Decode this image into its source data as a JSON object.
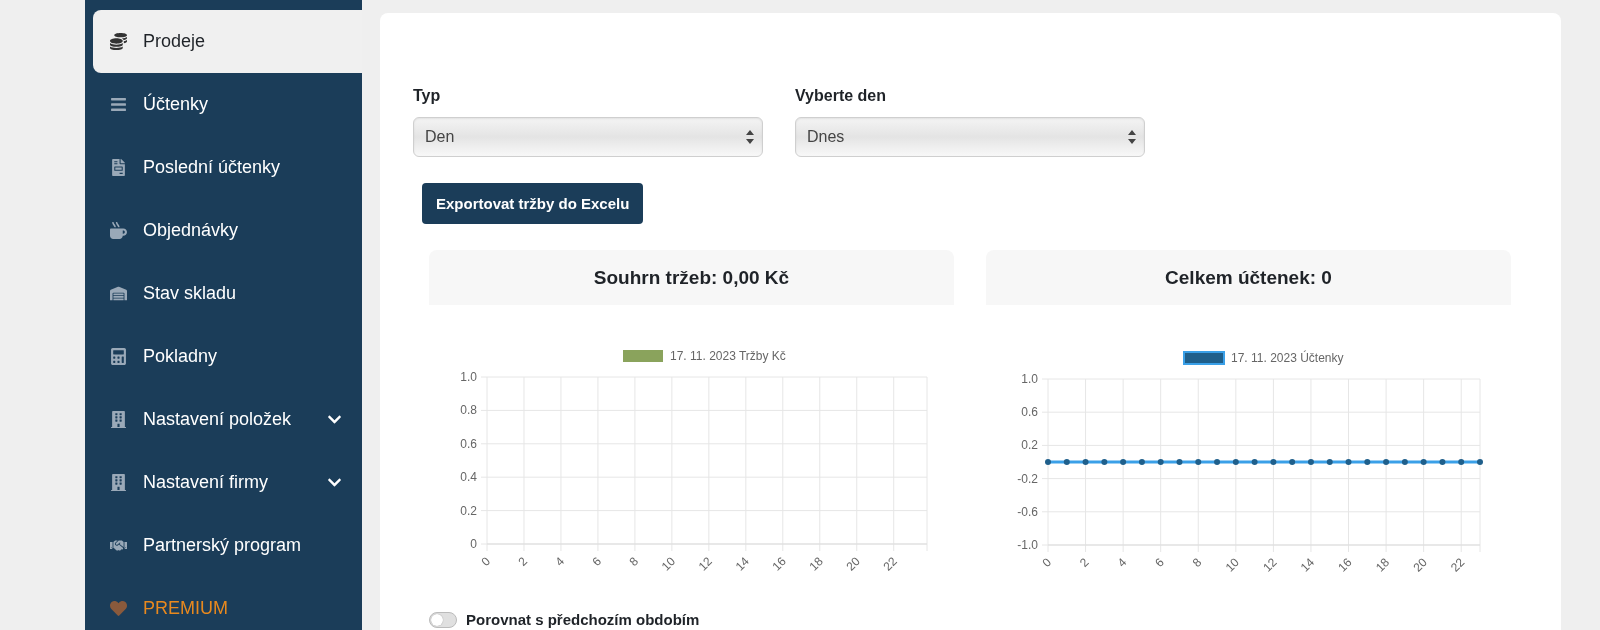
{
  "sidebar": {
    "items": [
      {
        "label": "Prodeje",
        "kind": "link",
        "selected": true
      },
      {
        "label": "Účtenky",
        "kind": "link",
        "selected": false
      },
      {
        "label": "Poslední účtenky",
        "kind": "link",
        "selected": false
      },
      {
        "label": "Objednávky",
        "kind": "link",
        "selected": false
      },
      {
        "label": "Stav skladu",
        "kind": "link",
        "selected": false
      },
      {
        "label": "Pokladny",
        "kind": "link",
        "selected": false
      },
      {
        "label": "Nastavení položek",
        "kind": "submenu",
        "selected": false
      },
      {
        "label": "Nastavení firmy",
        "kind": "submenu",
        "selected": false
      },
      {
        "label": "Partnerský program",
        "kind": "link",
        "selected": false
      },
      {
        "label": "PREMIUM",
        "kind": "premium",
        "selected": false
      }
    ]
  },
  "filters": [
    {
      "label": "Typ",
      "value": "Den"
    },
    {
      "label": "Vyberte den",
      "value": "Dnes"
    }
  ],
  "export_button": "Exportovat tržby do Excelu",
  "panels": [
    {
      "title": "Souhrn tržeb: 0,00 Kč",
      "chart_data": {
        "type": "bar",
        "x": [
          0,
          1,
          2,
          3,
          4,
          5,
          6,
          7,
          8,
          9,
          10,
          11,
          12,
          13,
          14,
          15,
          16,
          17,
          18,
          19,
          20,
          21,
          22,
          23
        ],
        "xticks": [
          0,
          2,
          4,
          6,
          8,
          10,
          12,
          14,
          16,
          18,
          20,
          22
        ],
        "xlim": [
          0,
          23.8
        ],
        "grid": true,
        "ylim": [
          0,
          1
        ],
        "yticks": [
          0,
          {
            "value": 0.2,
            "label": "0.2"
          },
          {
            "value": 0.4,
            "label": "0.4"
          },
          {
            "value": 0.6,
            "label": "0.6"
          },
          {
            "value": 0.8,
            "label": "0.8"
          },
          {
            "value": 1,
            "label": "1.0"
          }
        ],
        "series": [
          {
            "name": "17. 11. 2023 Tržby Kč",
            "color": "#8aa35c",
            "values": [
              0,
              0,
              0,
              0,
              0,
              0,
              0,
              0,
              0,
              0,
              0,
              0,
              0,
              0,
              0,
              0,
              0,
              0,
              0,
              0,
              0,
              0,
              0,
              0
            ]
          }
        ]
      }
    },
    {
      "title": "Celkem účtenek: 0",
      "chart_data": {
        "type": "line",
        "x": [
          0,
          1,
          2,
          3,
          4,
          5,
          6,
          7,
          8,
          9,
          10,
          11,
          12,
          13,
          14,
          15,
          16,
          17,
          18,
          19,
          20,
          21,
          22,
          23
        ],
        "xticks": [
          0,
          2,
          4,
          6,
          8,
          10,
          12,
          14,
          16,
          18,
          20,
          22
        ],
        "xlim": [
          0,
          23
        ],
        "grid": true,
        "ylim": [
          -1,
          1
        ],
        "yticks": [
          {
            "value": -1,
            "label": "-1.0"
          },
          {
            "value": -0.6,
            "label": "-0.6"
          },
          {
            "value": -0.2,
            "label": "-0.2"
          },
          {
            "value": 0.2,
            "label": "0.2"
          },
          {
            "value": 0.6,
            "label": "0.6"
          },
          {
            "value": 1,
            "label": "1.0"
          }
        ],
        "series": [
          {
            "name": "17. 11. 2023 Účtenky",
            "color": "#3aa0e8",
            "marker": true,
            "values": [
              0,
              0,
              0,
              0,
              0,
              0,
              0,
              0,
              0,
              0,
              0,
              0,
              0,
              0,
              0,
              0,
              0,
              0,
              0,
              0,
              0,
              0,
              0,
              0
            ]
          }
        ]
      }
    }
  ],
  "compare": {
    "label": "Porovnat s předchozím obdobím",
    "on": false
  }
}
